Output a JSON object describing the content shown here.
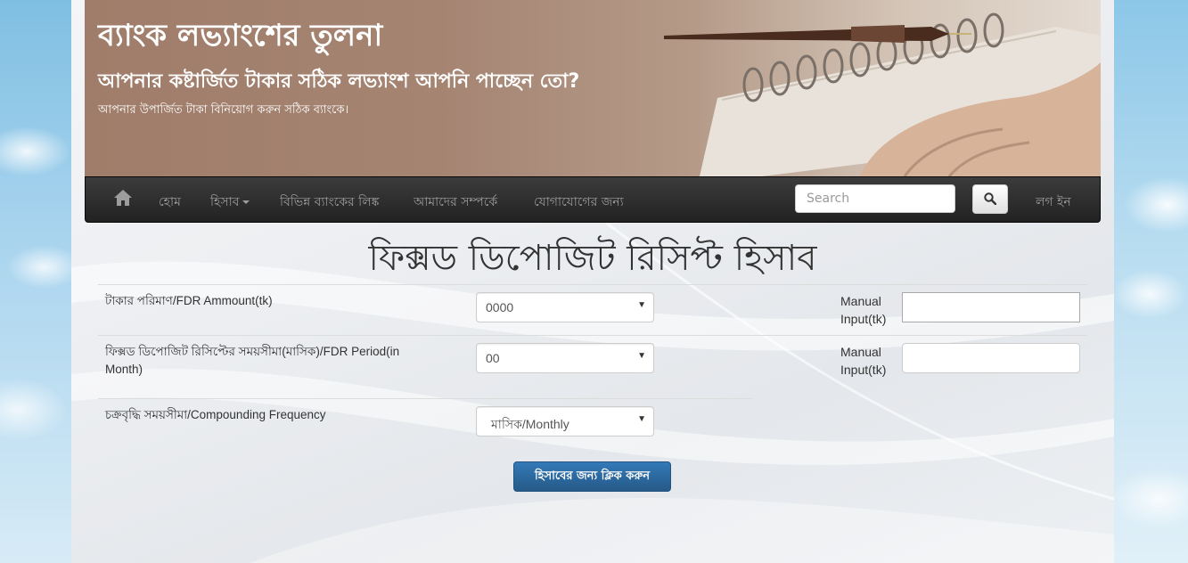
{
  "banner": {
    "title": "ব্যাংক লভ্যাংশের তুলনা",
    "subtitle": "আপনার কষ্টার্জিত টাকার সঠিক লভ্যাংশ আপনি পাচ্ছেন তো?",
    "tagline": "আপনার উপার্জিত টাকা বিনিয়োগ করুন সঠিক ব্যাংকে।"
  },
  "nav": {
    "home_icon": "home-icon",
    "items": [
      {
        "label": "হোম"
      },
      {
        "label": "হিসাব"
      },
      {
        "label": "বিভিন্ন ব্যাংকের লিঙ্ক"
      },
      {
        "label": "আমাদের সম্পর্কে"
      },
      {
        "label": "যোগাযোগের জন্য"
      }
    ],
    "search_placeholder": "Search",
    "search_icon": "search-icon",
    "login_label": "লগ ইন"
  },
  "page": {
    "heading": "ফিক্সড ডিপোজিট রিসিপ্ট হিসাব"
  },
  "form": {
    "amount": {
      "label": "টাকার পরিমাণ/FDR Ammount(tk)",
      "selected": "0000",
      "manual_label": "Manual Input(tk)",
      "manual_value": ""
    },
    "period": {
      "label": "ফিক্সড ডিপোজিট রিসিপ্টের সময়সীমা(মাসিক)/FDR Period(in Month)",
      "selected": "00",
      "manual_label": "Manual Input(tk)",
      "manual_value": ""
    },
    "frequency": {
      "label": "চক্রবৃদ্ধি সময়সীমা/Compounding Frequency",
      "selected": "মাসিক/Monthly"
    },
    "submit_label": "হিসাবের জন্য ক্লিক করুন"
  },
  "colors": {
    "navbar": "#222222",
    "primary_button": "#337ab7",
    "banner": "#a58472"
  }
}
